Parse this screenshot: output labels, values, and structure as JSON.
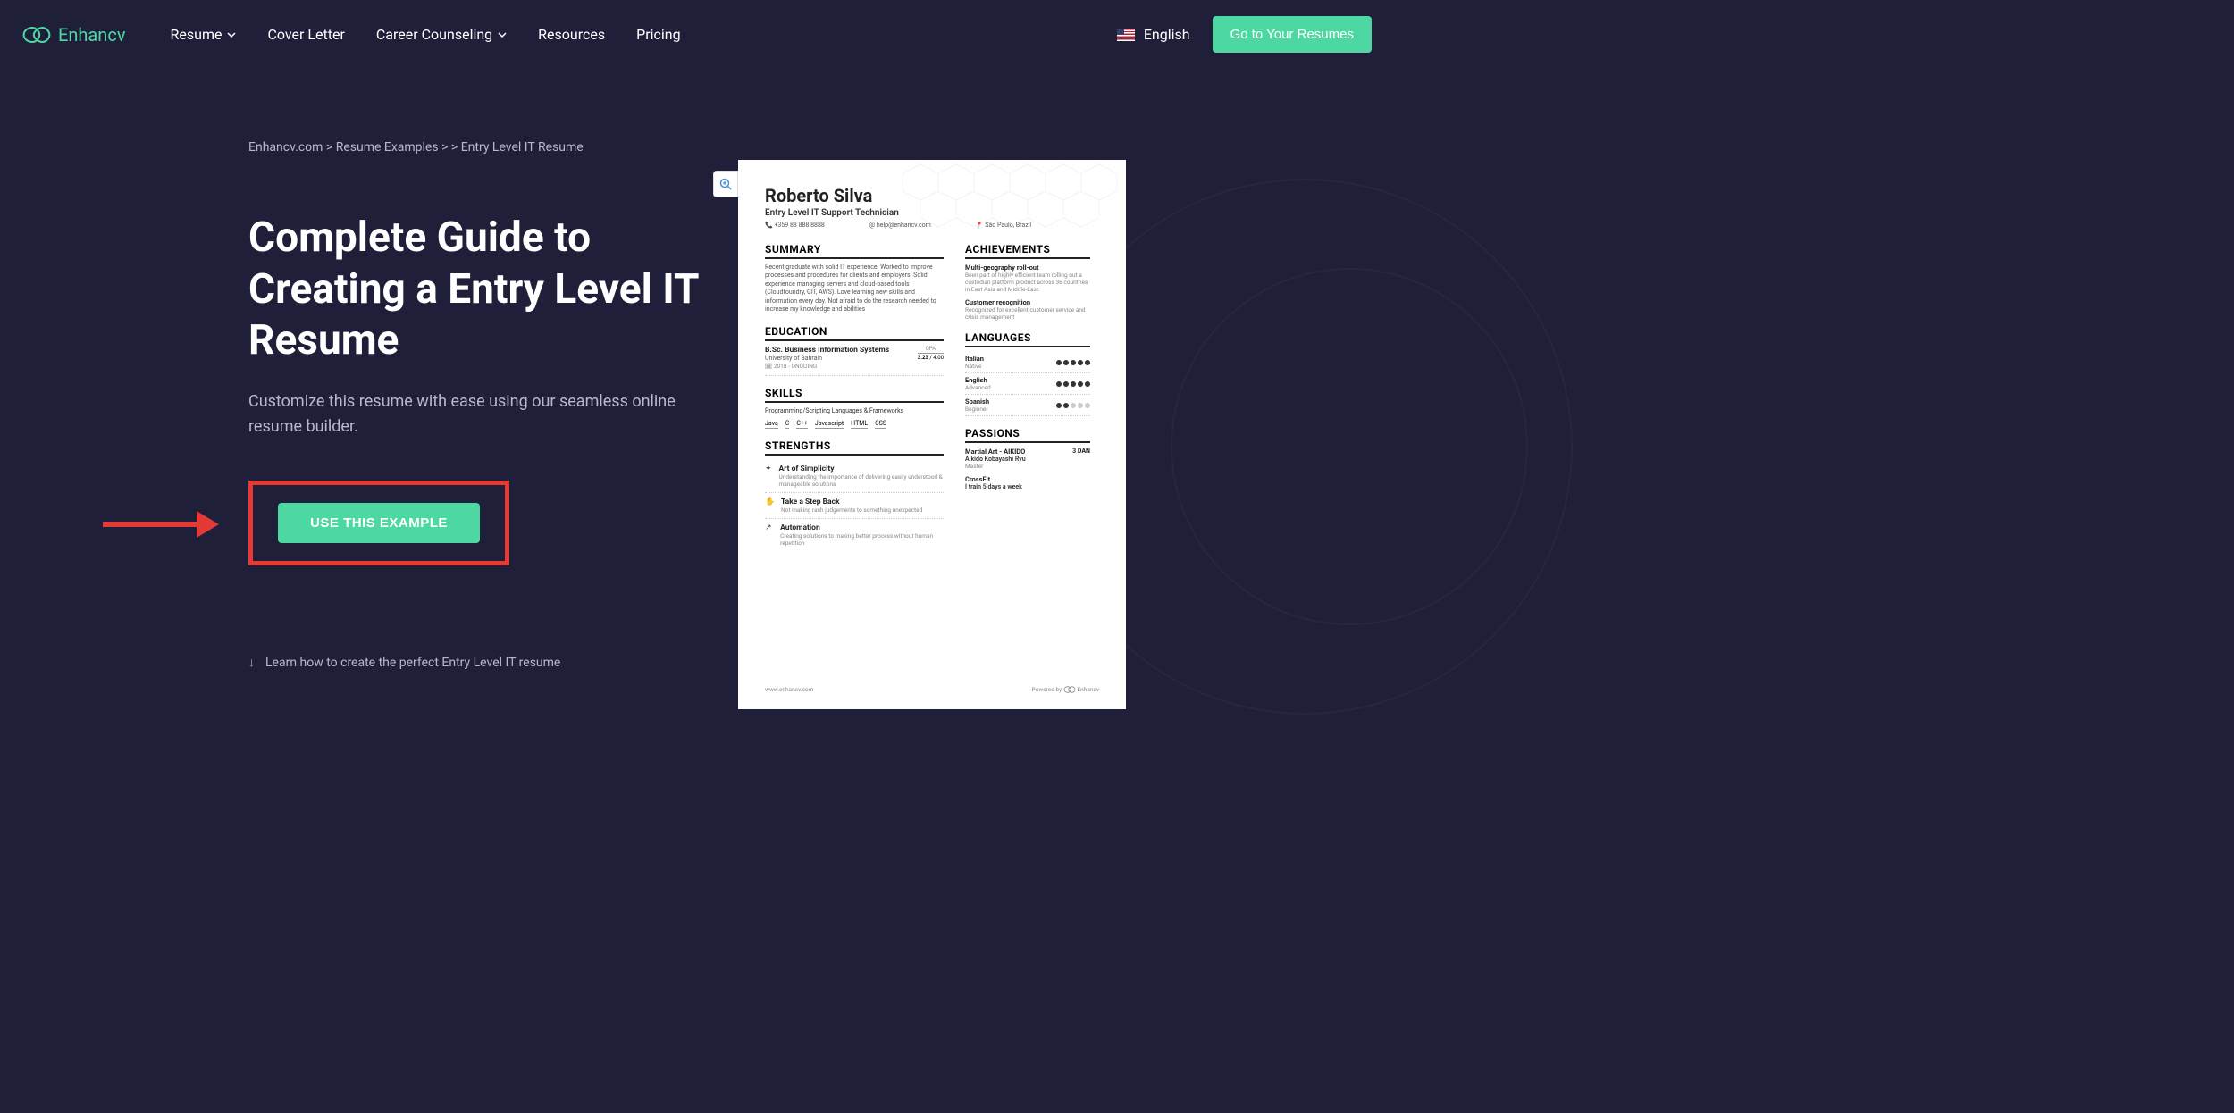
{
  "brand": "Enhancv",
  "nav": {
    "resume": "Resume",
    "cover_letter": "Cover Letter",
    "career": "Career Counseling",
    "resources": "Resources",
    "pricing": "Pricing"
  },
  "header": {
    "language": "English",
    "cta": "Go to Your Resumes"
  },
  "breadcrumb": {
    "home": "Enhancv.com",
    "sep": ">",
    "examples": "Resume Examples",
    "current": "Entry Level IT Resume"
  },
  "page": {
    "title": "Complete Guide to Creating a Entry Level IT Resume",
    "subtitle": "Customize this resume with ease using our seamless online resume builder.",
    "cta": "USE THIS EXAMPLE",
    "learn": "Learn how to create the perfect Entry Level IT resume"
  },
  "resume": {
    "name": "Roberto Silva",
    "role": "Entry Level IT Support Technician",
    "phone": "+359 88 888 8888",
    "email": "help@enhancv.com",
    "location": "São Paulo, Brazil",
    "summary_title": "SUMMARY",
    "summary_text": "Recent graduate with solid IT experience. Worked to improve processes and procedures for clients and employers. Solid experience managing servers and cloud-based tools (Cloudfoundry, GIT, AWS). Love learning new skills and information every day. Not afraid to do the research needed to increase my knowledge and abilities",
    "education_title": "EDUCATION",
    "education": {
      "degree": "B.Sc. Business Information Systems",
      "school": "University of Bahrain",
      "dates": "2018 - ONGOING",
      "gpa_label": "GPA",
      "gpa": "3.23",
      "gpa_max": "4.00"
    },
    "skills_title": "SKILLS",
    "skills_sub": "Programming/Scripting Languages & Frameworks",
    "skills": [
      "Java",
      "C",
      "C++",
      "Javascript",
      "HTML",
      "CSS"
    ],
    "strengths_title": "STRENGTHS",
    "strengths": [
      {
        "icon": "✦",
        "title": "Art of Simplicity",
        "desc": "Understanding the importance of delivering easily understood & manageable solutions"
      },
      {
        "icon": "✋",
        "title": "Take a Step Back",
        "desc": "Not making rash judgements to something unexpected"
      },
      {
        "icon": "↗",
        "title": "Automation",
        "desc": "Creating solutions to making better process without human repetition"
      }
    ],
    "achievements_title": "ACHIEVEMENTS",
    "achievements": [
      {
        "title": "Multi-geography roll-out",
        "desc": "Been part of highly efficient team rolling out a custodian platform product across 36 countries in East Asia and Middle-East."
      },
      {
        "title": "Customer recognition",
        "desc": "Recognized for excellent customer service and crisis management"
      }
    ],
    "languages_title": "LANGUAGES",
    "languages": [
      {
        "name": "Italian",
        "level": "Native",
        "dots": 5
      },
      {
        "name": "English",
        "level": "Advanced",
        "dots": 5
      },
      {
        "name": "Spanish",
        "level": "Beginner",
        "dots": 2
      }
    ],
    "passions_title": "PASSIONS",
    "passions": [
      {
        "title": "Martial Art - AIKIDO",
        "sub": "Aikido Kobayashi Ryu",
        "level": "Master",
        "badge": "3 DAN"
      },
      {
        "title": "CrossFit",
        "sub": "I train 5 days a week",
        "level": "",
        "badge": ""
      }
    ],
    "footer_url": "www.enhancv.com",
    "footer_powered": "Powered by",
    "footer_brand": "Enhancv"
  }
}
